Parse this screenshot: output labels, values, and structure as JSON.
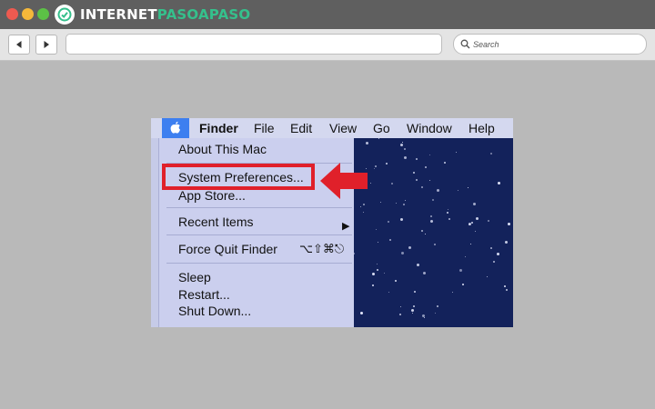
{
  "browser": {
    "brand_internet": "INTERNET",
    "brand_paso": "PASOAPASO",
    "search_label": "Search",
    "icons": [
      "back-icon",
      "forward-icon",
      "search-icon",
      "brand-logo-icon"
    ]
  },
  "screenshot": {
    "menubar": {
      "apple_icon": "apple-icon",
      "items": [
        "Finder",
        "File",
        "Edit",
        "View",
        "Go",
        "Window",
        "Help"
      ]
    },
    "apple_menu": {
      "about": "About This Mac",
      "system_preferences": "System Preferences...",
      "app_store": "App Store...",
      "recent_items": "Recent Items",
      "force_quit": "Force Quit Finder",
      "force_quit_shortcut": "⌥⇧⌘⎋",
      "sleep": "Sleep",
      "restart": "Restart...",
      "shut_down": "Shut Down..."
    },
    "annotation": {
      "highlight_color": "#e0202a",
      "pointer": "red-arrow-pointer"
    }
  },
  "colors": {
    "chrome_dark": "#5f5f5f",
    "toolbar": "#e4e4e4",
    "page_background": "#b9b9b9",
    "desktop": "#13225b",
    "menu": "#cbcfee",
    "brand_green": "#35c08c"
  }
}
